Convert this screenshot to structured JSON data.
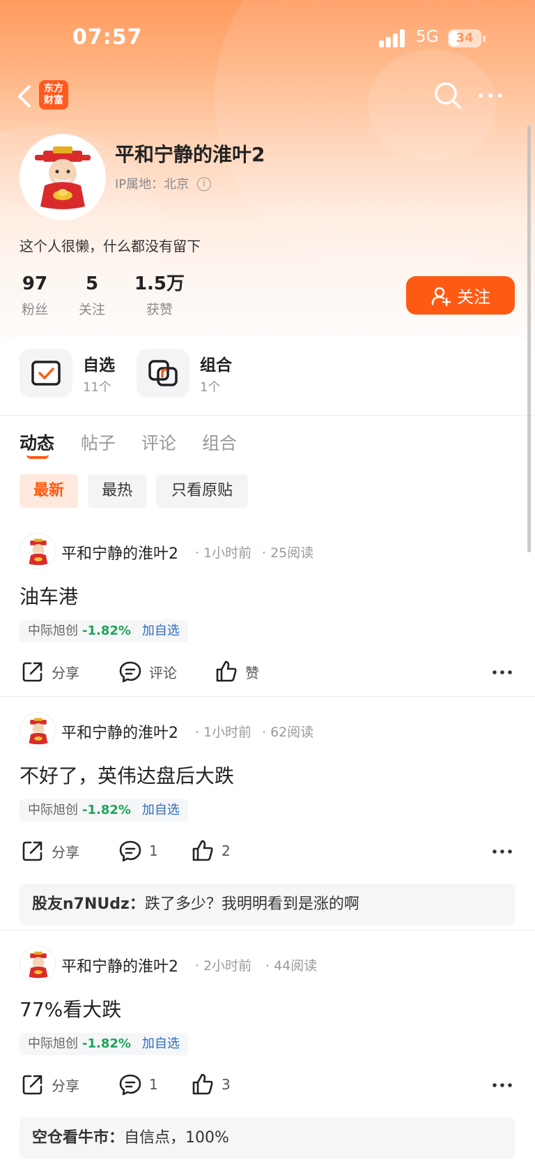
{
  "status_bar": {
    "time": "07:57",
    "network": "5G",
    "battery": "34",
    "battery_level": 0.34
  },
  "nav": {
    "brand_logo": "东方财富",
    "brand_logo_line1": "东方",
    "brand_logo_line2": "财富",
    "icons": [
      "back-arrow-icon",
      "search-icon",
      "more-icon"
    ]
  },
  "profile": {
    "name": "平和宁静的淮叶2",
    "ip_location": "IP属地：北京",
    "bio": "这个人很懒，什么都没有留下",
    "stats": [
      {
        "value": "97",
        "label": "粉丝"
      },
      {
        "value": "5",
        "label": "关注"
      },
      {
        "value": "1.5万",
        "label": "获赞"
      }
    ],
    "follow_button": "关注"
  },
  "quick_access": [
    {
      "title": "自选",
      "sub": "11个",
      "icon": "watchlist-check-icon"
    },
    {
      "title": "组合",
      "sub": "1个",
      "icon": "portfolio-icon"
    }
  ],
  "tabs": [
    {
      "label": "动态",
      "active": true
    },
    {
      "label": "帖子",
      "active": false
    },
    {
      "label": "评论",
      "active": false
    },
    {
      "label": "组合",
      "active": false
    }
  ],
  "filters": [
    {
      "label": "最新",
      "active": true
    },
    {
      "label": "最热",
      "active": false
    },
    {
      "label": "只看原贴",
      "active": false
    }
  ],
  "posts": [
    {
      "author": "平和宁静的淮叶2",
      "time": "1小时前",
      "reads": "25阅读",
      "text": "油车港",
      "stock": {
        "name": "中际旭创",
        "change": "-1.82%",
        "add": "加自选"
      },
      "share": "分享",
      "comment": "评论",
      "like": "赞",
      "reply": null
    },
    {
      "author": "平和宁静的淮叶2",
      "time": "1小时前",
      "reads": "62阅读",
      "text": "不好了，英伟达盘后大跌",
      "stock": {
        "name": "中际旭创",
        "change": "-1.82%",
        "add": "加自选"
      },
      "share": "分享",
      "comment": "1",
      "like": "2",
      "reply": {
        "user": "股友n7NUdz：",
        "text": "跌了多少？我明明看到是涨的啊"
      }
    },
    {
      "author": "平和宁静的淮叶2",
      "time": "2小时前",
      "reads": "44阅读",
      "text": "77%看大跌",
      "stock": {
        "name": "中际旭创",
        "change": "-1.82%",
        "add": "加自选"
      },
      "share": "分享",
      "comment": "1",
      "like": "3",
      "reply": {
        "user": "空仓看牛市：",
        "text": "自信点，100%"
      }
    }
  ],
  "colors": {
    "accent": "#ff5a14",
    "stock_down": "#20a35a",
    "link": "#2f6cc0"
  }
}
